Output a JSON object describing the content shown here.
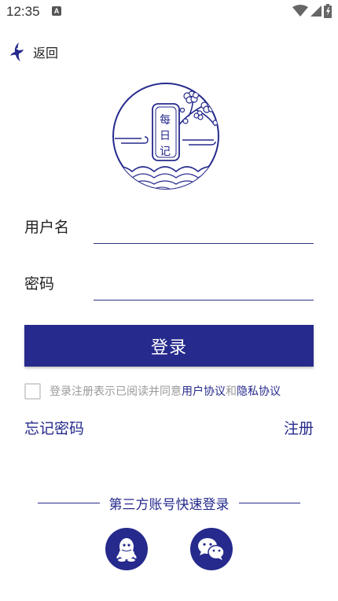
{
  "status_bar": {
    "time": "12:35",
    "notification_badge": "A",
    "icons": [
      "wifi-icon",
      "signal-icon",
      "battery-icon"
    ]
  },
  "nav": {
    "back_label": "返回",
    "back_icon": "swallow-icon"
  },
  "logo": {
    "text_chars": [
      "每",
      "日",
      "记"
    ]
  },
  "form": {
    "username_label": "用户名",
    "username_value": "",
    "password_label": "密码",
    "password_value": ""
  },
  "login_button": "登录",
  "agreement": {
    "checked": false,
    "prefix": "登录注册表示已阅读并同意",
    "user_agreement": "用户协议",
    "conjunction": "和",
    "privacy_policy": "隐私协议"
  },
  "links": {
    "forgot_password": "忘记密码",
    "register": "注册"
  },
  "third_party": {
    "title": "第三方账号快速登录",
    "providers": [
      "qq-icon",
      "wechat-icon"
    ]
  },
  "colors": {
    "accent": "#262a8c",
    "muted_text": "#9a9a9a",
    "checkbox_border": "#d3d3d3"
  }
}
